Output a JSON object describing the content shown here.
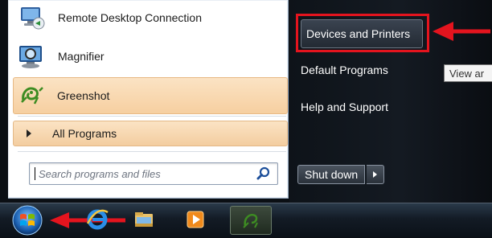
{
  "start_menu": {
    "programs": [
      {
        "label": "Remote Desktop Connection",
        "icon": "remote-desktop-icon"
      },
      {
        "label": "Magnifier",
        "icon": "magnifier-icon"
      },
      {
        "label": "Greenshot",
        "icon": "greenshot-icon"
      }
    ],
    "all_programs_label": "All Programs",
    "search_placeholder": "Search programs and files",
    "right_items": [
      {
        "label": "Devices and Printers"
      },
      {
        "label": "Default Programs"
      },
      {
        "label": "Help and Support"
      }
    ],
    "tooltip_text": "View ar",
    "shutdown_label": "Shut down"
  },
  "annotation": {
    "highlight_color": "#e4141e"
  },
  "taskbar": {
    "items": [
      "start-orb",
      "internet-explorer-icon",
      "file-explorer-icon",
      "media-player-icon",
      "greenshot-taskbar-icon"
    ]
  }
}
